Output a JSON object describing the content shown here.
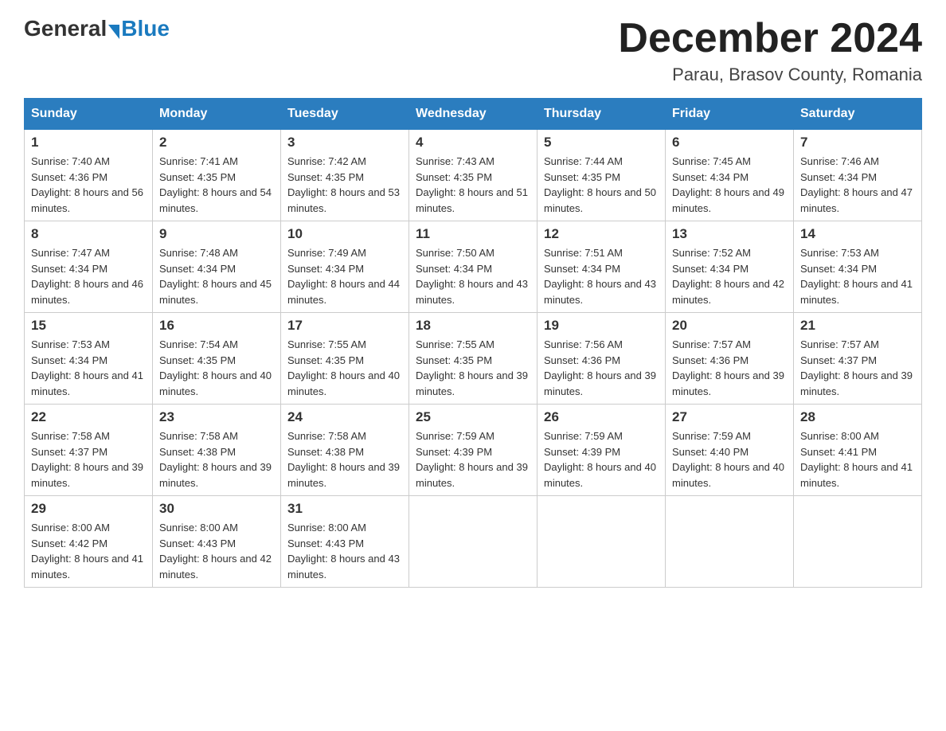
{
  "header": {
    "logo_general": "General",
    "logo_blue": "Blue",
    "month_title": "December 2024",
    "location": "Parau, Brasov County, Romania"
  },
  "weekdays": [
    "Sunday",
    "Monday",
    "Tuesday",
    "Wednesday",
    "Thursday",
    "Friday",
    "Saturday"
  ],
  "weeks": [
    [
      {
        "day": "1",
        "sunrise": "7:40 AM",
        "sunset": "4:36 PM",
        "daylight": "8 hours and 56 minutes."
      },
      {
        "day": "2",
        "sunrise": "7:41 AM",
        "sunset": "4:35 PM",
        "daylight": "8 hours and 54 minutes."
      },
      {
        "day": "3",
        "sunrise": "7:42 AM",
        "sunset": "4:35 PM",
        "daylight": "8 hours and 53 minutes."
      },
      {
        "day": "4",
        "sunrise": "7:43 AM",
        "sunset": "4:35 PM",
        "daylight": "8 hours and 51 minutes."
      },
      {
        "day": "5",
        "sunrise": "7:44 AM",
        "sunset": "4:35 PM",
        "daylight": "8 hours and 50 minutes."
      },
      {
        "day": "6",
        "sunrise": "7:45 AM",
        "sunset": "4:34 PM",
        "daylight": "8 hours and 49 minutes."
      },
      {
        "day": "7",
        "sunrise": "7:46 AM",
        "sunset": "4:34 PM",
        "daylight": "8 hours and 47 minutes."
      }
    ],
    [
      {
        "day": "8",
        "sunrise": "7:47 AM",
        "sunset": "4:34 PM",
        "daylight": "8 hours and 46 minutes."
      },
      {
        "day": "9",
        "sunrise": "7:48 AM",
        "sunset": "4:34 PM",
        "daylight": "8 hours and 45 minutes."
      },
      {
        "day": "10",
        "sunrise": "7:49 AM",
        "sunset": "4:34 PM",
        "daylight": "8 hours and 44 minutes."
      },
      {
        "day": "11",
        "sunrise": "7:50 AM",
        "sunset": "4:34 PM",
        "daylight": "8 hours and 43 minutes."
      },
      {
        "day": "12",
        "sunrise": "7:51 AM",
        "sunset": "4:34 PM",
        "daylight": "8 hours and 43 minutes."
      },
      {
        "day": "13",
        "sunrise": "7:52 AM",
        "sunset": "4:34 PM",
        "daylight": "8 hours and 42 minutes."
      },
      {
        "day": "14",
        "sunrise": "7:53 AM",
        "sunset": "4:34 PM",
        "daylight": "8 hours and 41 minutes."
      }
    ],
    [
      {
        "day": "15",
        "sunrise": "7:53 AM",
        "sunset": "4:34 PM",
        "daylight": "8 hours and 41 minutes."
      },
      {
        "day": "16",
        "sunrise": "7:54 AM",
        "sunset": "4:35 PM",
        "daylight": "8 hours and 40 minutes."
      },
      {
        "day": "17",
        "sunrise": "7:55 AM",
        "sunset": "4:35 PM",
        "daylight": "8 hours and 40 minutes."
      },
      {
        "day": "18",
        "sunrise": "7:55 AM",
        "sunset": "4:35 PM",
        "daylight": "8 hours and 39 minutes."
      },
      {
        "day": "19",
        "sunrise": "7:56 AM",
        "sunset": "4:36 PM",
        "daylight": "8 hours and 39 minutes."
      },
      {
        "day": "20",
        "sunrise": "7:57 AM",
        "sunset": "4:36 PM",
        "daylight": "8 hours and 39 minutes."
      },
      {
        "day": "21",
        "sunrise": "7:57 AM",
        "sunset": "4:37 PM",
        "daylight": "8 hours and 39 minutes."
      }
    ],
    [
      {
        "day": "22",
        "sunrise": "7:58 AM",
        "sunset": "4:37 PM",
        "daylight": "8 hours and 39 minutes."
      },
      {
        "day": "23",
        "sunrise": "7:58 AM",
        "sunset": "4:38 PM",
        "daylight": "8 hours and 39 minutes."
      },
      {
        "day": "24",
        "sunrise": "7:58 AM",
        "sunset": "4:38 PM",
        "daylight": "8 hours and 39 minutes."
      },
      {
        "day": "25",
        "sunrise": "7:59 AM",
        "sunset": "4:39 PM",
        "daylight": "8 hours and 39 minutes."
      },
      {
        "day": "26",
        "sunrise": "7:59 AM",
        "sunset": "4:39 PM",
        "daylight": "8 hours and 40 minutes."
      },
      {
        "day": "27",
        "sunrise": "7:59 AM",
        "sunset": "4:40 PM",
        "daylight": "8 hours and 40 minutes."
      },
      {
        "day": "28",
        "sunrise": "8:00 AM",
        "sunset": "4:41 PM",
        "daylight": "8 hours and 41 minutes."
      }
    ],
    [
      {
        "day": "29",
        "sunrise": "8:00 AM",
        "sunset": "4:42 PM",
        "daylight": "8 hours and 41 minutes."
      },
      {
        "day": "30",
        "sunrise": "8:00 AM",
        "sunset": "4:43 PM",
        "daylight": "8 hours and 42 minutes."
      },
      {
        "day": "31",
        "sunrise": "8:00 AM",
        "sunset": "4:43 PM",
        "daylight": "8 hours and 43 minutes."
      },
      null,
      null,
      null,
      null
    ]
  ]
}
